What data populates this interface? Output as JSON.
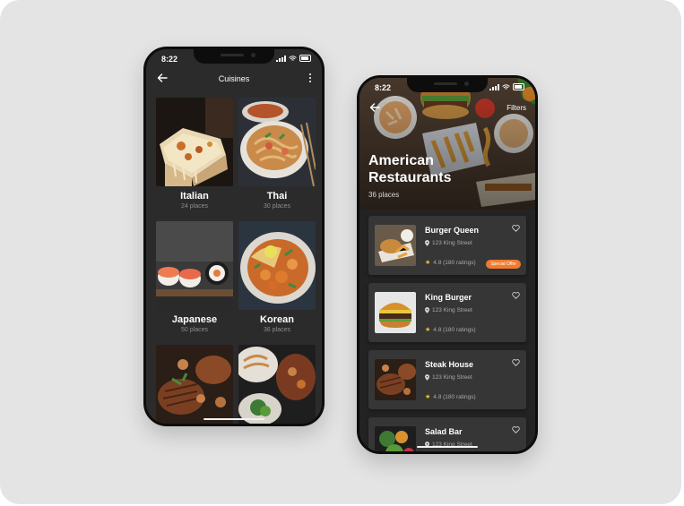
{
  "colors": {
    "screen_bg": "#2b2b2b",
    "card_bg": "#363636",
    "accent": "#f07a2e",
    "star": "#f4c431"
  },
  "cuisines_screen": {
    "status_time": "8:22",
    "title": "Cuisines",
    "items": [
      {
        "name": "Italian",
        "count": "24 places"
      },
      {
        "name": "Thai",
        "count": "30 places"
      },
      {
        "name": "Japanese",
        "count": "50 places"
      },
      {
        "name": "Korean",
        "count": "36 places"
      },
      {
        "name": "",
        "count": ""
      },
      {
        "name": "",
        "count": ""
      }
    ]
  },
  "restaurants_screen": {
    "status_time": "8:22",
    "filters_label": "Filters",
    "title": "American Restaurants",
    "subtitle": "36 places",
    "restaurants": [
      {
        "name": "Burger Queen",
        "address": "123 King Street",
        "rating": "4.8 (180 ratings)",
        "badge": "Special Offer"
      },
      {
        "name": "King Burger",
        "address": "123 King Street",
        "rating": "4.8 (180 ratings)",
        "badge": ""
      },
      {
        "name": "Steak House",
        "address": "123 King Street",
        "rating": "4.8 (180 ratings)",
        "badge": ""
      },
      {
        "name": "Salad Bar",
        "address": "123 King Street",
        "rating": "",
        "badge": ""
      }
    ]
  },
  "icons": [
    "back-arrow-icon",
    "more-vertical-icon",
    "signal-icon",
    "wifi-icon",
    "battery-icon",
    "heart-icon",
    "location-pin-icon",
    "star-icon"
  ]
}
